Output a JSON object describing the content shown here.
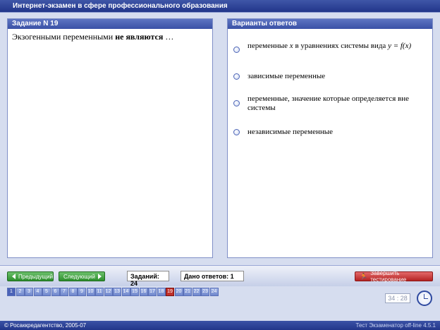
{
  "window": {
    "title": "Интернет-экзамен в сфере профессионального образования"
  },
  "left_panel": {
    "header": "Задание N 19",
    "question_pre": "Экзогенными переменными",
    "question_bold": "не являются",
    "question_post": "…"
  },
  "right_panel": {
    "header": "Варианты ответов",
    "options": [
      {
        "text_pre": "переменные",
        "var_x": "x",
        "text_mid": "в уравнениях системы вида",
        "formula": "y = f(x)"
      },
      {
        "text": "зависимые переменные"
      },
      {
        "text": "переменные, значение которые определяется вне системы"
      },
      {
        "text": "независимые переменные"
      }
    ]
  },
  "toolbar": {
    "prev_label": "Предыдущий",
    "next_label": "Следующий",
    "tasks_count": "Заданий: 24",
    "answers_given": "Дано ответов: 1",
    "finish_label": "Завершить тестирование"
  },
  "question_numbers": [
    "1",
    "2",
    "3",
    "4",
    "5",
    "6",
    "7",
    "8",
    "9",
    "10",
    "11",
    "12",
    "13",
    "14",
    "15",
    "16",
    "17",
    "18",
    "19",
    "20",
    "21",
    "22",
    "23",
    "24"
  ],
  "current_question": "19",
  "timer": "34 : 28",
  "status": {
    "left": "© Росаккредагентство, 2005-07",
    "right": "Тест Экзаменатор off-line 4.5.1"
  },
  "colors": {
    "accent": "#3a51a6",
    "nav_button": "#2d8f2d",
    "finish_button": "#b52323",
    "current_question": "#c0302a"
  }
}
